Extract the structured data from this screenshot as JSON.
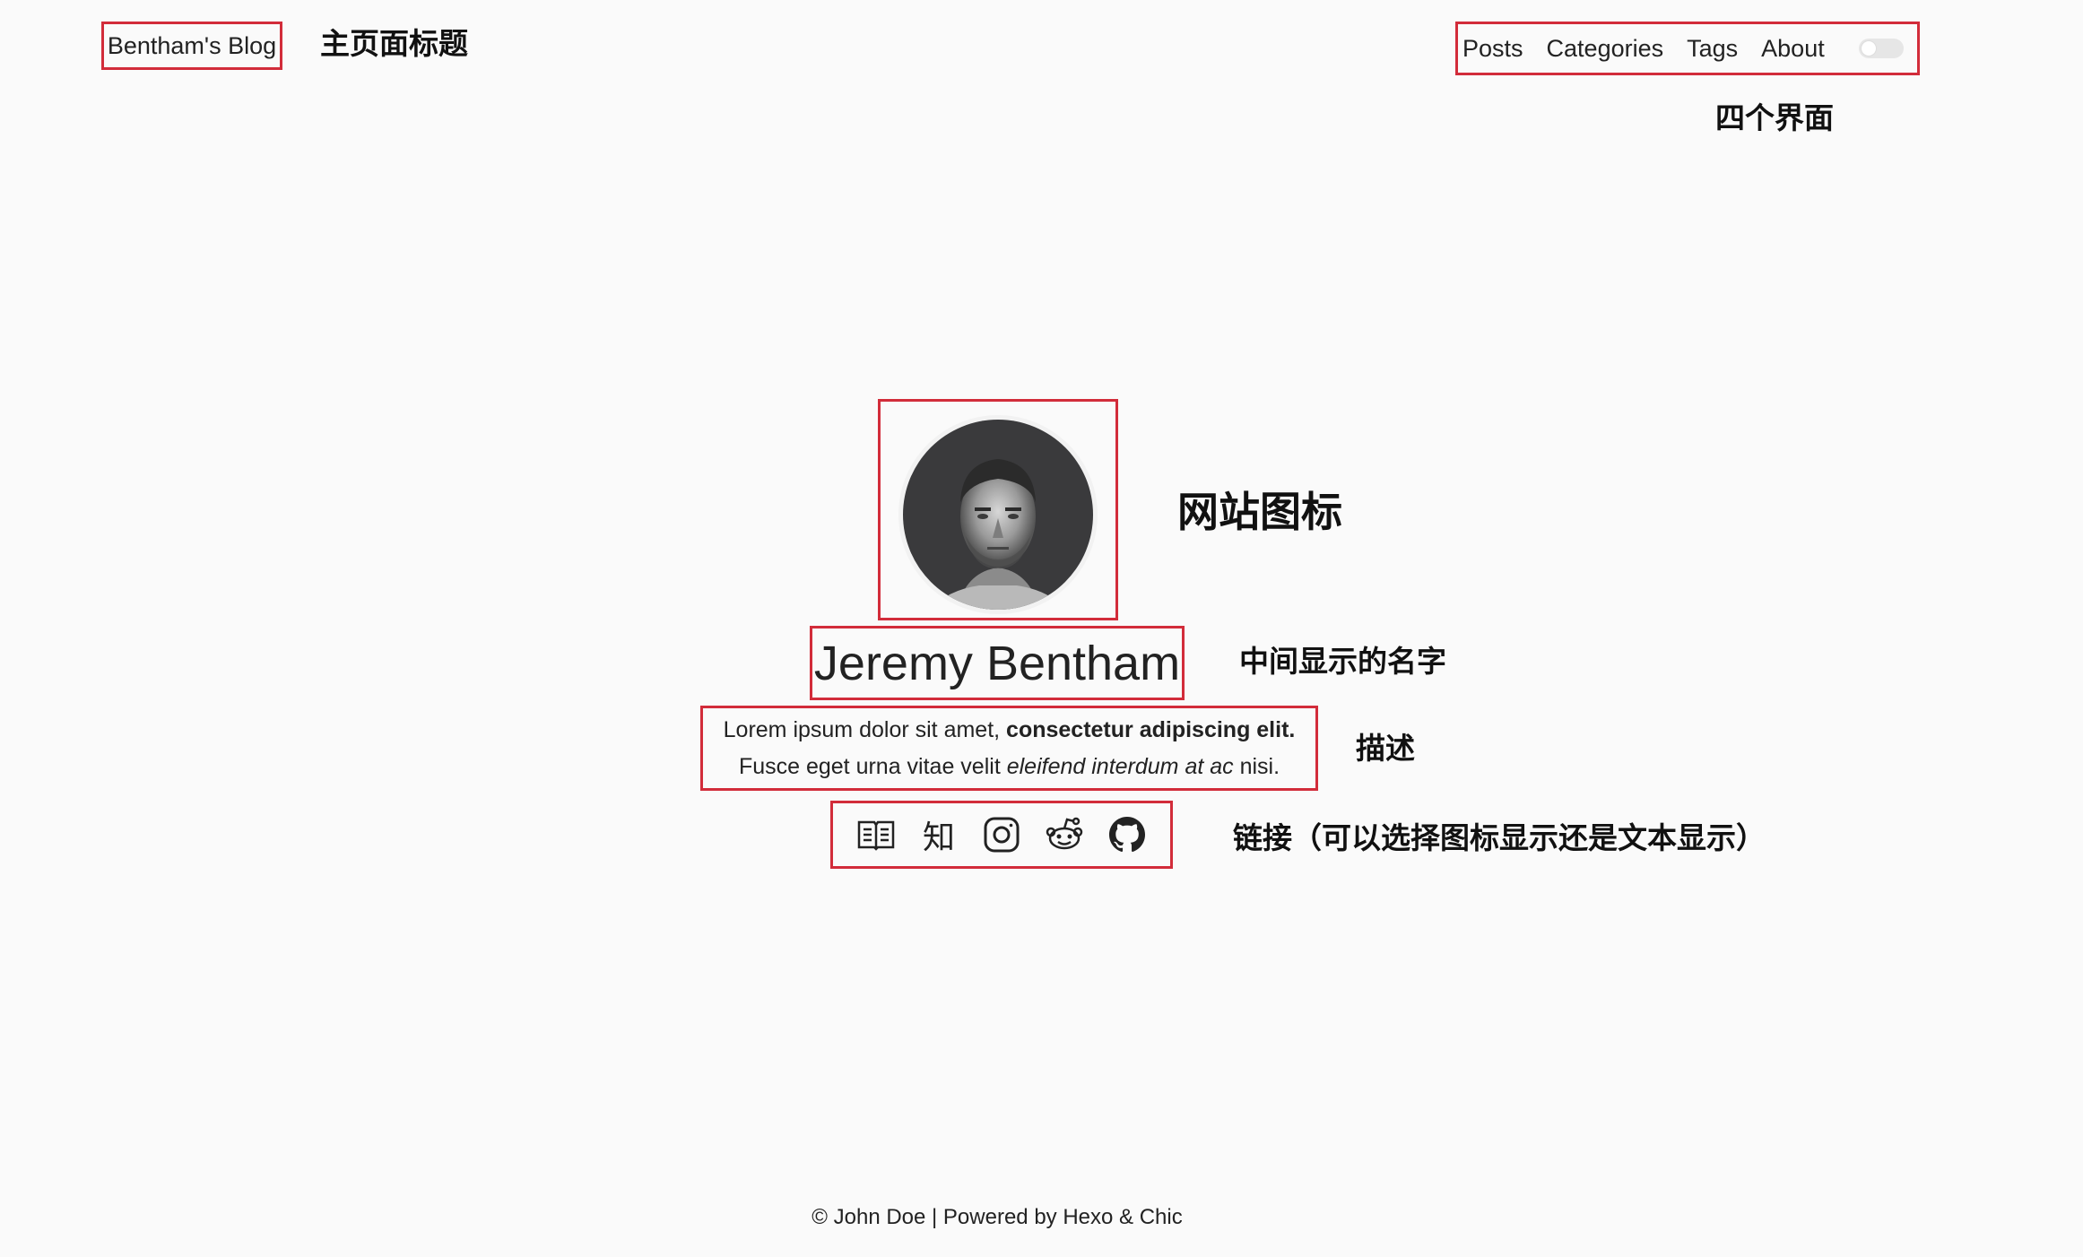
{
  "header": {
    "blog_title": "Bentham's Blog",
    "nav": [
      {
        "label": "Posts"
      },
      {
        "label": "Categories"
      },
      {
        "label": "Tags"
      },
      {
        "label": "About"
      }
    ],
    "dark_mode_toggle": "off"
  },
  "profile": {
    "name": "Jeremy Bentham",
    "desc_line1_normal": "Lorem ipsum dolor sit amet, ",
    "desc_line1_bold": "consectetur adipiscing elit.",
    "desc_line2_normal": "Fusce eget urna vitae velit ",
    "desc_line2_italic": "eleifend interdum at ac",
    "desc_line2_end": " nisi.",
    "links": [
      {
        "icon": "book-icon"
      },
      {
        "icon": "zhihu-icon",
        "glyph": "知"
      },
      {
        "icon": "instagram-icon"
      },
      {
        "icon": "reddit-icon"
      },
      {
        "icon": "github-icon"
      }
    ]
  },
  "annotations": {
    "title": "主页面标题",
    "nav": "四个界面",
    "avatar": "网站图标",
    "name": "中间显示的名字",
    "desc": "描述",
    "links": "链接（可以选择图标显示还是文本显示）"
  },
  "footer": {
    "text": "© John Doe | Powered by Hexo & Chic"
  },
  "colors": {
    "annotation_box": "#d22c3a",
    "background": "#fafafa",
    "text": "#222222"
  }
}
